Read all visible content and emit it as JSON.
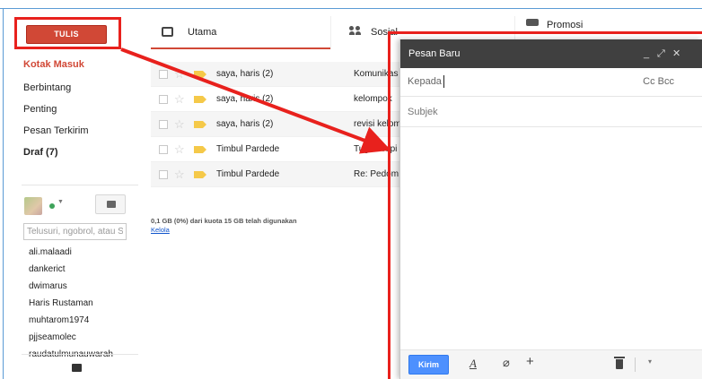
{
  "sidebar": {
    "compose_label": "TULIS",
    "nav": [
      {
        "label": "Kotak Masuk",
        "active": true
      },
      {
        "label": "Berbintang"
      },
      {
        "label": "Penting"
      },
      {
        "label": "Pesan Terkirim"
      },
      {
        "label": "Draf (7)",
        "bold": true
      }
    ],
    "chat_search_placeholder": "Telusuri, ngobrol, atau S",
    "contacts": [
      "ali.malaadi",
      "dankerict",
      "dwimarus",
      "Haris Rustaman",
      "muhtarom1974",
      "pjjseamolec",
      "raudatulmunauwarah"
    ],
    "status_color": "#3ea35a"
  },
  "tabs": [
    {
      "label": "Utama",
      "icon": "inbox-icon"
    },
    {
      "label": "Sosial",
      "icon": "people-icon"
    },
    {
      "label": "Promosi",
      "icon": "tag-icon"
    }
  ],
  "emails": [
    {
      "sender": "saya, haris (2)",
      "subject": "Komunikas"
    },
    {
      "sender": "saya, haris (2)",
      "subject": "kelompok"
    },
    {
      "sender": "saya, haris (2)",
      "subject": "revisi kelom"
    },
    {
      "sender": "Timbul Pardede",
      "subject": "Tugas Topi"
    },
    {
      "sender": "Timbul Pardede",
      "subject": "Re: Pedom"
    }
  ],
  "footer": {
    "quota": "0,1 GB (0%) dari kuota 15 GB telah digunakan",
    "manage": "Kelola"
  },
  "compose": {
    "title": "Pesan Baru",
    "minimize": "_",
    "expand": "⤢",
    "close": "✕",
    "to_label": "Kepada",
    "cc_bcc": "Cc  Bcc",
    "subject_label": "Subjek",
    "send_label": "Kirim",
    "format_label": "A",
    "attach_glyph": "⌀",
    "more_glyph": "+",
    "more_options_glyph": "▾"
  },
  "colors": {
    "compose_button": "#d14836",
    "send_button": "#4d90fe",
    "annotation": "#e8211d",
    "compose_header": "#404040"
  }
}
